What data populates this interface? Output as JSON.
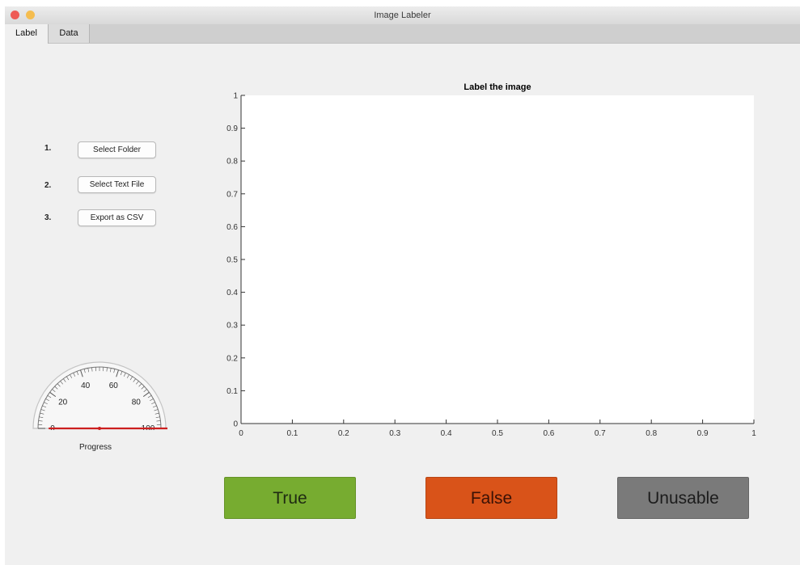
{
  "window": {
    "title": "Image Labeler",
    "colors": {
      "close": "#ee5a55",
      "minimize": "#f5bd4f"
    }
  },
  "tabs": [
    {
      "label": "Label",
      "active": true
    },
    {
      "label": "Data",
      "active": false
    }
  ],
  "steps": [
    {
      "number": "1.",
      "button": "Select Folder"
    },
    {
      "number": "2.",
      "button": "Select Text File"
    },
    {
      "number": "3.",
      "button": "Export as CSV"
    }
  ],
  "gauge": {
    "label": "Progress",
    "tick_labels": [
      "0",
      "20",
      "40",
      "60",
      "80",
      "100"
    ],
    "value": 0,
    "min": 0,
    "max": 100,
    "needle_color": "#cc1f1f"
  },
  "axes": {
    "title": "Label the image",
    "x_ticks": [
      "0",
      "0.1",
      "0.2",
      "0.3",
      "0.4",
      "0.5",
      "0.6",
      "0.7",
      "0.8",
      "0.9",
      "1"
    ],
    "y_ticks": [
      "0",
      "0.1",
      "0.2",
      "0.3",
      "0.4",
      "0.5",
      "0.6",
      "0.7",
      "0.8",
      "0.9",
      "1"
    ],
    "xlim": [
      0,
      1
    ],
    "ylim": [
      0,
      1
    ]
  },
  "actions": {
    "true_label": "True",
    "false_label": "False",
    "unusable_label": "Unusable",
    "true_color": "#77ac30",
    "false_color": "#d95319",
    "unusable_color": "#7a7a7a"
  }
}
